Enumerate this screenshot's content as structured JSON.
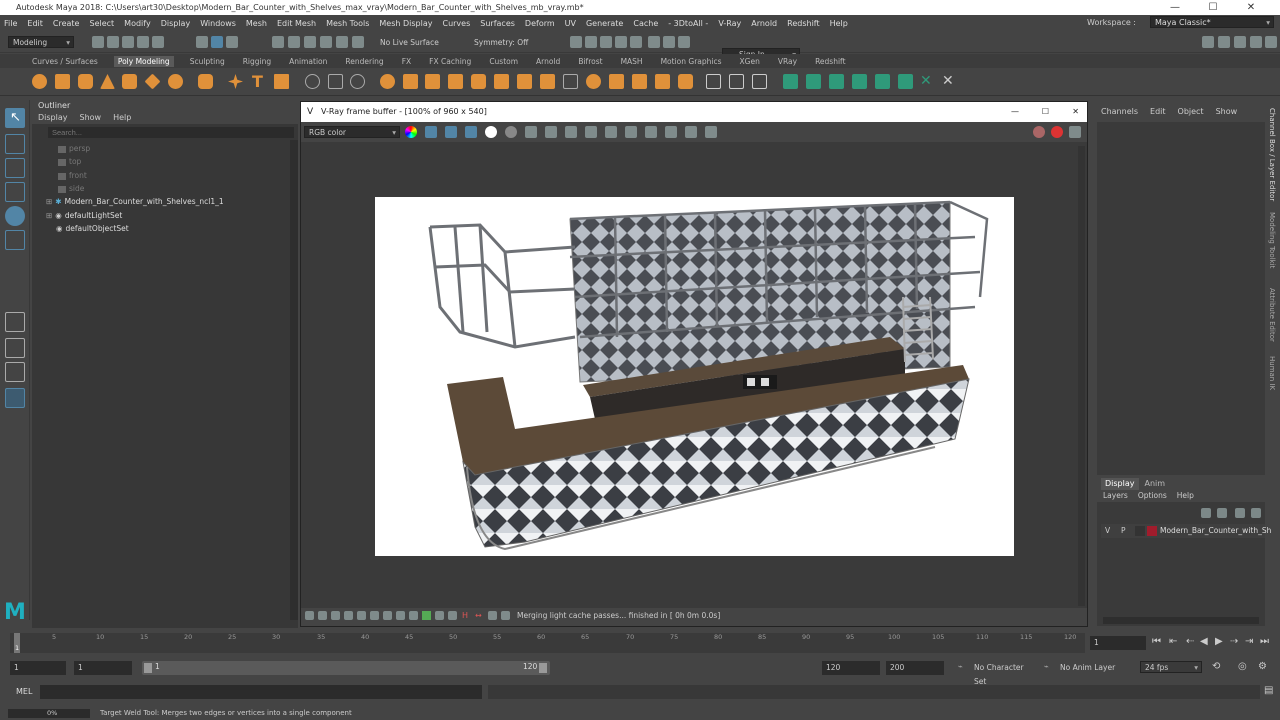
{
  "window": {
    "title": "Autodesk Maya 2018: C:\\Users\\art30\\Desktop\\Modern_Bar_Counter_with_Shelves_max_vray\\Modern_Bar_Counter_with_Shelves_mb_vray.mb*"
  },
  "menubar": {
    "items": [
      "File",
      "Edit",
      "Create",
      "Select",
      "Modify",
      "Display",
      "Windows",
      "Mesh",
      "Edit Mesh",
      "Mesh Tools",
      "Mesh Display",
      "Curves",
      "Surfaces",
      "Deform",
      "UV",
      "Generate",
      "Cache",
      "- 3DtoAll -",
      "V-Ray",
      "Arnold",
      "Redshift",
      "Help"
    ],
    "workspace_label": "Workspace :",
    "workspace_value": "Maya Classic*"
  },
  "statusline": {
    "mode": "Modeling",
    "live_surface": "No Live Surface",
    "symmetry": "Symmetry: Off",
    "sign_in": "Sign In"
  },
  "shelf": {
    "tabs": [
      "Curves / Surfaces",
      "Poly Modeling",
      "Sculpting",
      "Rigging",
      "Animation",
      "Rendering",
      "FX",
      "FX Caching",
      "Custom",
      "Arnold",
      "Bifrost",
      "MASH",
      "Motion Graphics",
      "XGen",
      "VRay",
      "Redshift"
    ],
    "active_tab": "Poly Modeling"
  },
  "outliner": {
    "title": "Outliner",
    "menu": [
      "Display",
      "Show",
      "Help"
    ],
    "search_placeholder": "Search...",
    "items": [
      {
        "label": "persp",
        "dim": true
      },
      {
        "label": "top",
        "dim": true
      },
      {
        "label": "front",
        "dim": true
      },
      {
        "label": "side",
        "dim": true
      },
      {
        "label": "Modern_Bar_Counter_with_Shelves_ncl1_1",
        "dim": false
      },
      {
        "label": "defaultLightSet",
        "dim": false
      },
      {
        "label": "defaultObjectSet",
        "dim": false
      }
    ]
  },
  "vfb": {
    "title": "V-Ray frame buffer - [100% of 960 x 540]",
    "channel": "RGB color",
    "status": "Merging light cache passes... finished in [ 0h  0m  0.0s]"
  },
  "channelbox": {
    "menu": [
      "Channels",
      "Edit",
      "Object",
      "Show"
    ]
  },
  "layereditor": {
    "tabs": [
      "Display",
      "Anim"
    ],
    "menu": [
      "Layers",
      "Options",
      "Help"
    ],
    "layer_v": "V",
    "layer_p": "P",
    "layer_name": "Modern_Bar_Counter_with_Sh"
  },
  "sidetabs": [
    "Channel Box / Layer Editor",
    "Modeling Toolkit",
    "Attribute Editor",
    "Human IK"
  ],
  "timeline": {
    "ticks": [
      "5",
      "10",
      "15",
      "20",
      "25",
      "30",
      "35",
      "40",
      "45",
      "50",
      "55",
      "60",
      "65",
      "70",
      "75",
      "80",
      "85",
      "90",
      "95",
      "100",
      "105",
      "110",
      "115",
      "120"
    ],
    "current_frame": "1",
    "start_frame": "1",
    "range_start": "1",
    "range_slider_start": "1",
    "range_slider_end": "120",
    "range_end": "120",
    "anim_end": "200",
    "character_set": "No Character Set",
    "anim_layer": "No Anim Layer",
    "fps": "24 fps",
    "marker": "1"
  },
  "commandline": {
    "label": "MEL"
  },
  "helpline": {
    "progress": "0%",
    "text": "Target Weld Tool: Merges two edges or vertices into a single component"
  }
}
